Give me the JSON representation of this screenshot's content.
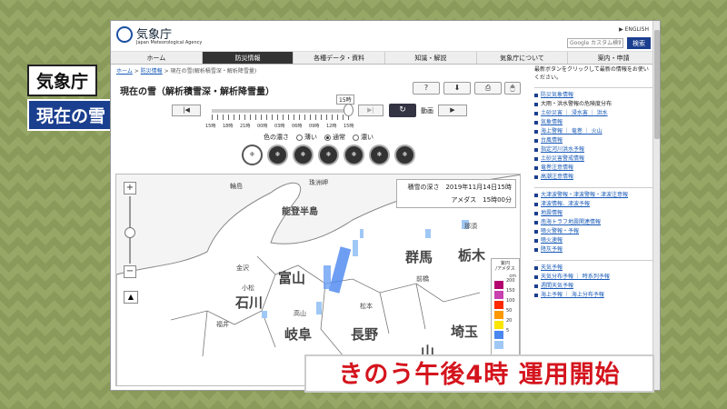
{
  "overlay": {
    "agency": "気象庁",
    "topic": "現在の雪",
    "banner": "きのう午後4時 運用開始"
  },
  "site": {
    "logo_text": "気象庁",
    "logo_en": "Japan Meteorological Agency",
    "english_link": "ENGLISH",
    "search_placeholder": "Google カスタム検索",
    "search_button": "検索"
  },
  "nav": [
    "ホーム",
    "防災情報",
    "各種データ・資料",
    "知識・解説",
    "気象庁について",
    "案内・申請"
  ],
  "breadcrumb": {
    "home": "ホーム",
    "sep1": " > ",
    "section": "防災情報",
    "sep2": " > ",
    "current": "現在の雪(解析積雪深・解析降雪量)"
  },
  "main": {
    "title": "現在の雪（解析積雪深・解析降雪量）",
    "help_icon": "?",
    "download_icon": "⬇",
    "print_icon": "⎙",
    "prev_icon": "|◀",
    "next_icon": "▶|",
    "refresh_icon": "↻",
    "anim_label": "動画",
    "play_icon": "▶",
    "slider_bubble": "15時",
    "time_ticks": [
      "15時",
      "18時",
      "21時",
      "00時",
      "03時",
      "06時",
      "09時",
      "12時",
      "15時"
    ],
    "shade_label": "色の濃さ",
    "shade_options": [
      "薄い",
      "通常",
      "濃い"
    ],
    "shade_selected": "通常"
  },
  "map": {
    "info_title": "積雪の深さ　2019年11月14日15時",
    "info_sub": "アメダス　15時00分",
    "legend_title_a": "紫円",
    "legend_title_b": "/アメダス",
    "legend_unit": "cm",
    "legend": [
      {
        "value": "200",
        "color": "#b4006e"
      },
      {
        "value": "150",
        "color": "#c940b0"
      },
      {
        "value": "100",
        "color": "#ff2800"
      },
      {
        "value": "50",
        "color": "#ff9900"
      },
      {
        "value": "20",
        "color": "#fae600"
      },
      {
        "value": "5",
        "color": "#4a86f0"
      },
      {
        "value": "",
        "color": "#9fc8f5"
      }
    ],
    "labels": {
      "noto": "能登半島",
      "wajima": "輪島",
      "toyama": "富山",
      "ishikawa": "石川",
      "gifu": "岐阜",
      "nagano": "長野",
      "gunma": "群馬",
      "tochigi": "栃木",
      "saitama": "埼玉",
      "yamanashi": "山",
      "fukui": "福井",
      "matsumoto": "松本",
      "maebashi": "前橋",
      "kanazawa": "金沢",
      "takayama": "高山",
      "nasu": "那須",
      "suzu": "珠洲岬",
      "komatsu": "小松"
    }
  },
  "right": {
    "intro": "最新ボタンをクリックして最新の情報をお使いください。",
    "group1": [
      {
        "label": "防災気象情報",
        "link": true
      },
      {
        "label": "大雨・洪水警報の危険度分布",
        "link": false
      },
      {
        "label": "土砂災害 ｜ 浸水害 ｜ 洪水",
        "link": true
      },
      {
        "label": "気象情報",
        "link": true
      },
      {
        "label": "海上警報 ｜ 竜巻 ｜ 火山",
        "link": true
      },
      {
        "label": "台風情報",
        "link": true
      },
      {
        "label": "指定河川洪水予報",
        "link": true
      },
      {
        "label": "土砂災害警戒情報",
        "link": true
      },
      {
        "label": "竜巻注意情報",
        "link": true
      },
      {
        "label": "高潮注意情報",
        "link": true
      }
    ],
    "group2": [
      {
        "label": "大津波警報・津波警報・津波注意報",
        "link": true
      },
      {
        "label": "津波情報、津波予報",
        "link": true
      },
      {
        "label": "地震情報",
        "link": true
      },
      {
        "label": "南海トラフ地震関連情報",
        "link": true
      },
      {
        "label": "噴火警報・予報",
        "link": true
      },
      {
        "label": "噴火速報",
        "link": true
      },
      {
        "label": "降灰予報",
        "link": true
      }
    ],
    "group3": [
      {
        "label": "天気予報",
        "link": true
      },
      {
        "label": "天気分布予報 ｜ 時系列予報",
        "link": true
      },
      {
        "label": "週間天気予報",
        "link": true
      },
      {
        "label": "海上予報 ｜ 海上分布予報",
        "link": true
      }
    ]
  }
}
